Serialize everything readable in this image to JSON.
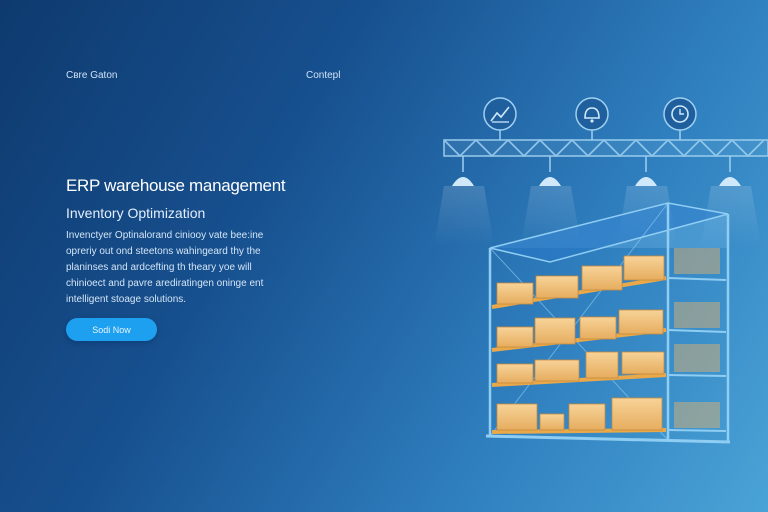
{
  "nav": {
    "link_1": "Cвre Gaton",
    "link_2": "Contepl"
  },
  "hero": {
    "title": "ERP warehouse management",
    "subtitle": "Inventory Optimization",
    "body_lines": [
      "Invenctyer Optinalorand ciniooy vate bee:ine",
      "opreriy out ond steetons wahingeard thy the",
      "planinses and ardcefting th theary yoe will",
      "chinioect and pavre arediratingen oninge ent",
      "intelligent stoage solutions."
    ],
    "cta_label": "Sodi Now"
  },
  "illustration": {
    "icons": [
      "chart-icon",
      "bell-icon",
      "clock-icon"
    ],
    "colors": {
      "truss": "#9fd0f0",
      "box": "#f2c27a",
      "shelf": "#e9a94a",
      "frame": "#8fcdf3"
    }
  }
}
